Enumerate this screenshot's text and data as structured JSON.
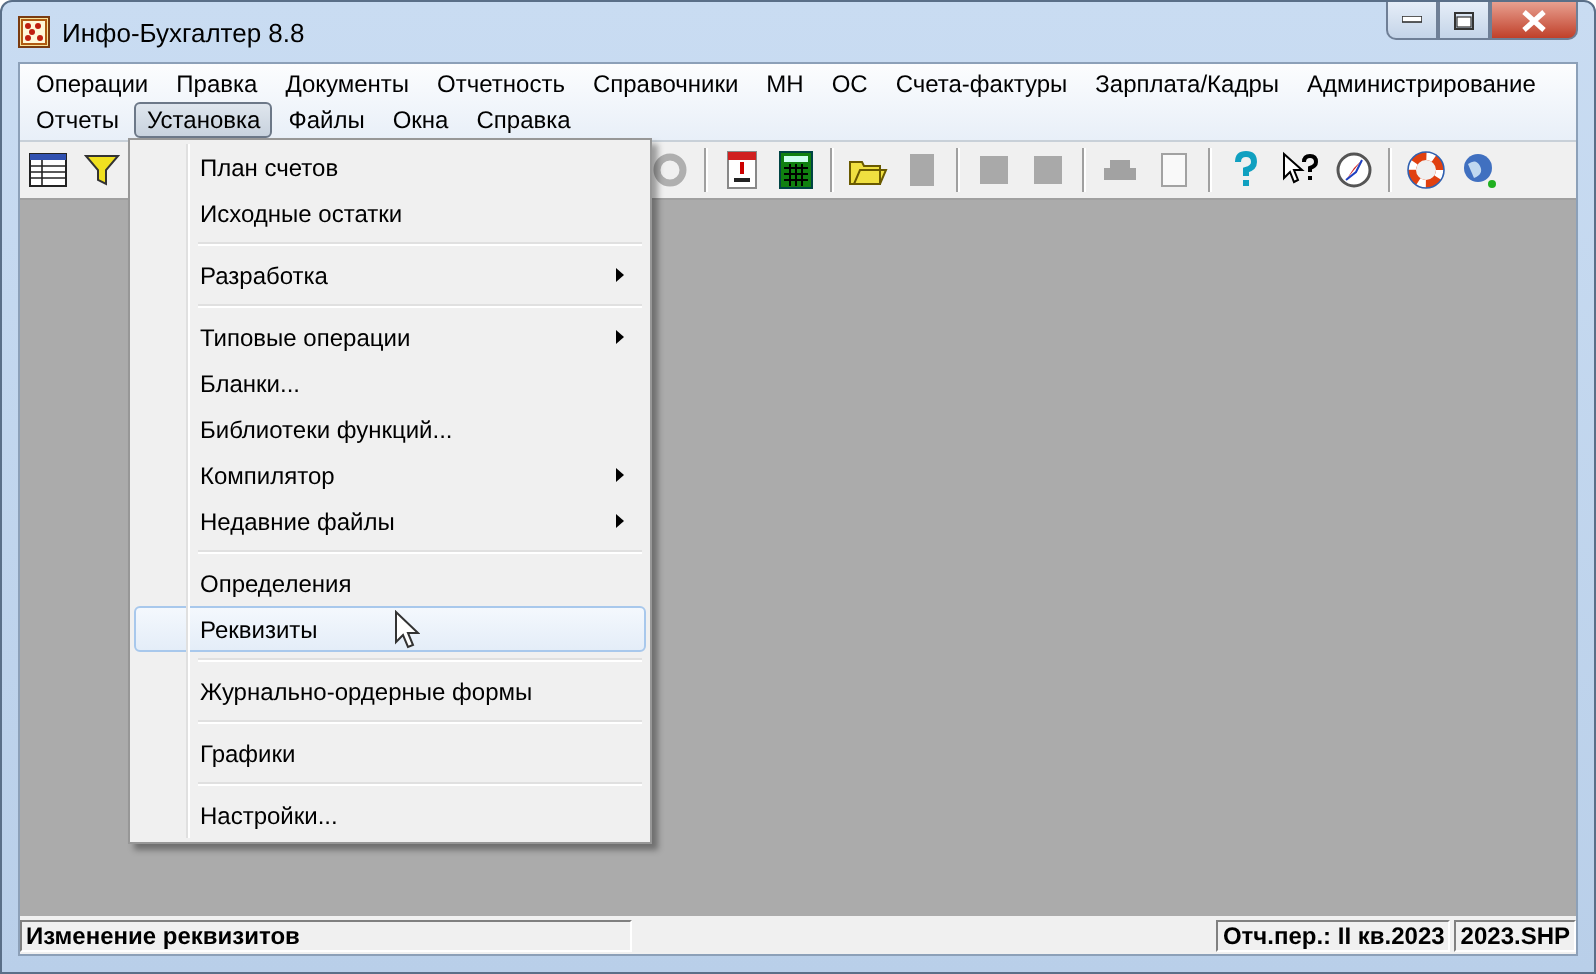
{
  "window": {
    "title": "Инфо-Бухгалтер 8.8"
  },
  "menu_bar": [
    {
      "label": "Операции",
      "selected": false
    },
    {
      "label": "Правка",
      "selected": false
    },
    {
      "label": "Документы",
      "selected": false
    },
    {
      "label": "Отчетность",
      "selected": false
    },
    {
      "label": "Справочники",
      "selected": false
    },
    {
      "label": "МН",
      "selected": false
    },
    {
      "label": "ОС",
      "selected": false
    },
    {
      "label": "Счета-фактуры",
      "selected": false
    },
    {
      "label": "Зарплата/Кадры",
      "selected": false
    },
    {
      "label": "Администрирование",
      "selected": false
    },
    {
      "label": "Отчеты",
      "selected": false
    },
    {
      "label": "Установка",
      "selected": true
    },
    {
      "label": "Файлы",
      "selected": false
    },
    {
      "label": "Окна",
      "selected": false
    },
    {
      "label": "Справка",
      "selected": false
    }
  ],
  "toolbar": [
    {
      "kind": "table",
      "disabled": false
    },
    {
      "kind": "filter",
      "disabled": false
    },
    {
      "kind": "gap"
    },
    {
      "kind": "redo",
      "disabled": true
    },
    {
      "kind": "sep"
    },
    {
      "kind": "calendar",
      "disabled": false
    },
    {
      "kind": "calculator",
      "disabled": false
    },
    {
      "kind": "sep"
    },
    {
      "kind": "folder",
      "disabled": false
    },
    {
      "kind": "document",
      "disabled": true
    },
    {
      "kind": "sep"
    },
    {
      "kind": "block",
      "disabled": true
    },
    {
      "kind": "block",
      "disabled": true
    },
    {
      "kind": "sep"
    },
    {
      "kind": "printer",
      "disabled": true
    },
    {
      "kind": "sheet",
      "disabled": true
    },
    {
      "kind": "sep"
    },
    {
      "kind": "help",
      "disabled": false
    },
    {
      "kind": "whatsthis",
      "disabled": false
    },
    {
      "kind": "compass",
      "disabled": false
    },
    {
      "kind": "sep"
    },
    {
      "kind": "lifebuoy",
      "disabled": false
    },
    {
      "kind": "globe",
      "disabled": false
    }
  ],
  "dropdown": [
    {
      "kind": "item",
      "label": "План счетов",
      "submenu": false,
      "selected": false
    },
    {
      "kind": "item",
      "label": "Исходные остатки",
      "submenu": false,
      "selected": false
    },
    {
      "kind": "separator"
    },
    {
      "kind": "item",
      "label": "Разработка",
      "submenu": true,
      "selected": false
    },
    {
      "kind": "separator"
    },
    {
      "kind": "item",
      "label": "Типовые операции",
      "submenu": true,
      "selected": false
    },
    {
      "kind": "item",
      "label": "Бланки...",
      "submenu": false,
      "selected": false
    },
    {
      "kind": "item",
      "label": "Библиотеки функций...",
      "submenu": false,
      "selected": false
    },
    {
      "kind": "item",
      "label": "Компилятор",
      "submenu": true,
      "selected": false
    },
    {
      "kind": "item",
      "label": "Недавние файлы",
      "submenu": true,
      "selected": false
    },
    {
      "kind": "separator"
    },
    {
      "kind": "item",
      "label": "Определения",
      "submenu": false,
      "selected": false
    },
    {
      "kind": "item",
      "label": "Реквизиты",
      "submenu": false,
      "selected": true
    },
    {
      "kind": "separator"
    },
    {
      "kind": "item",
      "label": "Журнально-ордерные формы",
      "submenu": false,
      "selected": false
    },
    {
      "kind": "separator"
    },
    {
      "kind": "item",
      "label": "Графики",
      "submenu": false,
      "selected": false
    },
    {
      "kind": "separator"
    },
    {
      "kind": "item",
      "label": "Настройки...",
      "submenu": false,
      "selected": false
    }
  ],
  "status_bar": {
    "message": "Изменение реквизитов",
    "period": "Отч.пер.: II кв.2023",
    "file": "2023.SHP"
  }
}
